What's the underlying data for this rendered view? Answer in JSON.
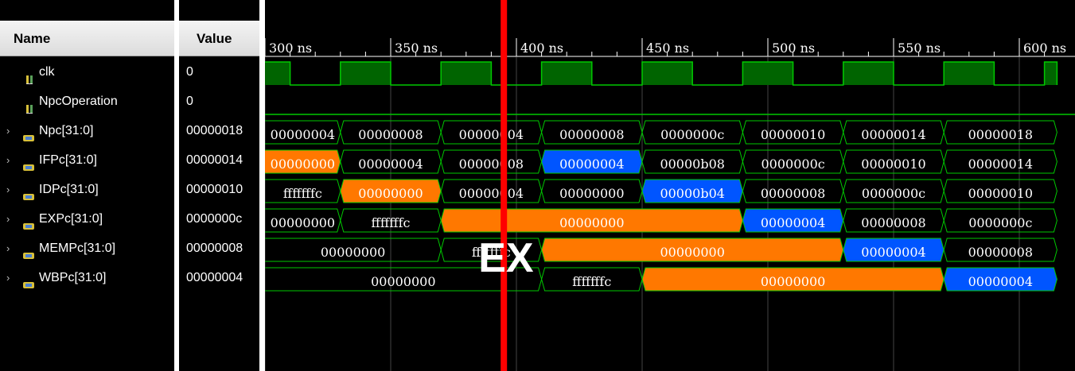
{
  "name_panel": {
    "header": "Name"
  },
  "value_panel": {
    "header": "Value"
  },
  "timeline": {
    "unit": "ns",
    "start": 290,
    "end": 615,
    "ticks": [
      {
        "t": 300,
        "label": "300 ns"
      },
      {
        "t": 350,
        "label": "350 ns"
      },
      {
        "t": 400,
        "label": "400 ns"
      },
      {
        "t": 450,
        "label": "450 ns"
      },
      {
        "t": 500,
        "label": "500 ns"
      },
      {
        "t": 550,
        "label": "550 ns"
      },
      {
        "t": 600,
        "label": "600 ns"
      }
    ],
    "cursor_time": 395,
    "cursor_color": "#ff0000",
    "annotation": "EX"
  },
  "colors": {
    "wave_line": "#00c800",
    "clk_fill": "#006400",
    "orange": "#ff7800",
    "blue": "#0055ff",
    "grid": "#444444"
  },
  "signals": [
    {
      "name": "clk",
      "type": "bit",
      "icon": "bit-signal-icon",
      "value": "0",
      "expandable": false,
      "clock": {
        "period": 40,
        "first_rise": 290,
        "high": 20
      }
    },
    {
      "name": "NpcOperation",
      "type": "bit",
      "icon": "bit-signal-icon",
      "value": "0",
      "expandable": false,
      "level": 0
    },
    {
      "name": "Npc[31:0]",
      "type": "bus",
      "icon": "bus-signal-icon",
      "value": "00000018",
      "expandable": true,
      "segments": [
        {
          "start": 290,
          "end": 330,
          "label": "00000004",
          "color": null
        },
        {
          "start": 330,
          "end": 370,
          "label": "00000008",
          "color": null
        },
        {
          "start": 370,
          "end": 410,
          "label": "00000004",
          "color": null
        },
        {
          "start": 410,
          "end": 450,
          "label": "00000008",
          "color": null
        },
        {
          "start": 450,
          "end": 490,
          "label": "0000000c",
          "color": null
        },
        {
          "start": 490,
          "end": 530,
          "label": "00000010",
          "color": null
        },
        {
          "start": 530,
          "end": 570,
          "label": "00000014",
          "color": null
        },
        {
          "start": 570,
          "end": 615,
          "label": "00000018",
          "color": null
        }
      ]
    },
    {
      "name": "IFPc[31:0]",
      "type": "bus",
      "icon": "bus-signal-icon",
      "value": "00000014",
      "expandable": true,
      "segments": [
        {
          "start": 290,
          "end": 330,
          "label": "00000000",
          "color": "orange"
        },
        {
          "start": 330,
          "end": 370,
          "label": "00000004",
          "color": null
        },
        {
          "start": 370,
          "end": 410,
          "label": "00000008",
          "color": null
        },
        {
          "start": 410,
          "end": 450,
          "label": "00000004",
          "color": "blue"
        },
        {
          "start": 450,
          "end": 490,
          "label": "00000b08",
          "color": null
        },
        {
          "start": 490,
          "end": 530,
          "label": "0000000c",
          "color": null
        },
        {
          "start": 530,
          "end": 570,
          "label": "00000010",
          "color": null
        },
        {
          "start": 570,
          "end": 615,
          "label": "00000014",
          "color": null
        }
      ]
    },
    {
      "name": "IDPc[31:0]",
      "type": "bus",
      "icon": "bus-signal-icon",
      "value": "00000010",
      "expandable": true,
      "segments": [
        {
          "start": 290,
          "end": 330,
          "label": "fffffffc",
          "color": null
        },
        {
          "start": 330,
          "end": 370,
          "label": "00000000",
          "color": "orange"
        },
        {
          "start": 370,
          "end": 410,
          "label": "00000004",
          "color": null
        },
        {
          "start": 410,
          "end": 450,
          "label": "00000000",
          "color": null
        },
        {
          "start": 450,
          "end": 490,
          "label": "00000b04",
          "color": "blue"
        },
        {
          "start": 490,
          "end": 530,
          "label": "00000008",
          "color": null
        },
        {
          "start": 530,
          "end": 570,
          "label": "0000000c",
          "color": null
        },
        {
          "start": 570,
          "end": 615,
          "label": "00000010",
          "color": null
        }
      ]
    },
    {
      "name": "EXPc[31:0]",
      "type": "bus",
      "icon": "bus-signal-icon",
      "value": "0000000c",
      "expandable": true,
      "segments": [
        {
          "start": 290,
          "end": 330,
          "label": "00000000",
          "color": null
        },
        {
          "start": 330,
          "end": 370,
          "label": "fffffffc",
          "color": null
        },
        {
          "start": 370,
          "end": 490,
          "label": "00000000",
          "color": "orange"
        },
        {
          "start": 490,
          "end": 530,
          "label": "00000004",
          "color": "blue"
        },
        {
          "start": 530,
          "end": 570,
          "label": "00000008",
          "color": null
        },
        {
          "start": 570,
          "end": 615,
          "label": "0000000c",
          "color": null
        }
      ]
    },
    {
      "name": "MEMPc[31:0]",
      "type": "bus",
      "icon": "bus-signal-icon",
      "value": "00000008",
      "expandable": true,
      "segments": [
        {
          "start": 290,
          "end": 370,
          "label": "00000000",
          "color": null
        },
        {
          "start": 370,
          "end": 410,
          "label": "fffffffc",
          "color": null
        },
        {
          "start": 410,
          "end": 530,
          "label": "00000000",
          "color": "orange"
        },
        {
          "start": 530,
          "end": 570,
          "label": "00000004",
          "color": "blue"
        },
        {
          "start": 570,
          "end": 615,
          "label": "00000008",
          "color": null
        }
      ]
    },
    {
      "name": "WBPc[31:0]",
      "type": "bus",
      "icon": "bus-signal-icon",
      "value": "00000004",
      "expandable": true,
      "segments": [
        {
          "start": 290,
          "end": 410,
          "label": "00000000",
          "color": null
        },
        {
          "start": 410,
          "end": 450,
          "label": "fffffffc",
          "color": null
        },
        {
          "start": 450,
          "end": 570,
          "label": "00000000",
          "color": "orange"
        },
        {
          "start": 570,
          "end": 615,
          "label": "00000004",
          "color": "blue"
        }
      ]
    }
  ]
}
